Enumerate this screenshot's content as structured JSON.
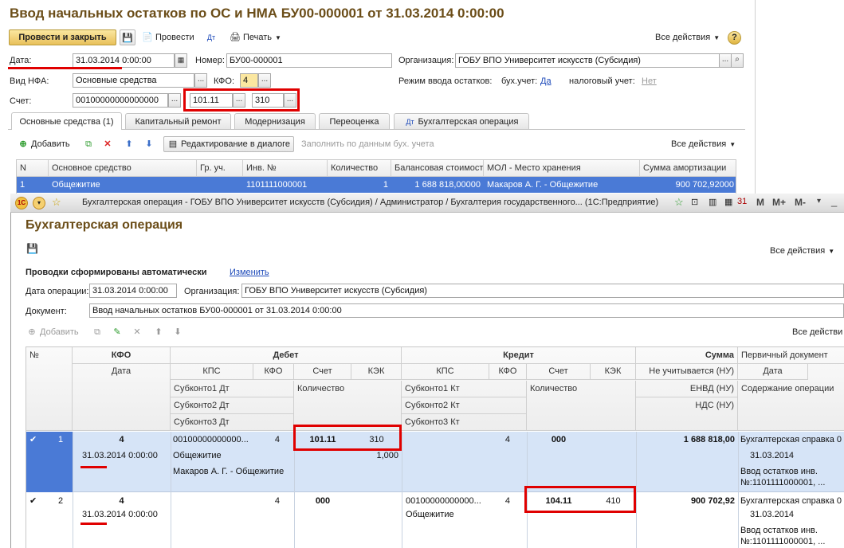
{
  "back": {
    "title": "Ввод начальных остатков по ОС и НМА БУ00-000001 от 31.03.2014 0:00:00",
    "toolbar": {
      "post_close": "Провести и закрыть",
      "post": "Провести",
      "print": "Печать",
      "all_actions": "Все действия",
      "help": "?"
    },
    "fields": {
      "date_label": "Дата:",
      "date_value": "31.03.2014  0:00:00",
      "number_label": "Номер:",
      "number_value": "БУ00-000001",
      "org_label": "Организация:",
      "org_value": "ГОБУ ВПО Университет искусств (Субсидия)",
      "nfa_label": "Вид НФА:",
      "nfa_value": "Основные средства",
      "kfo_label": "КФО:",
      "kfo_value": "4",
      "mode_label": "Режим ввода остатков:",
      "bu_label": "бух.учет:",
      "bu_value": "Да",
      "nu_label": "налоговый учет:",
      "nu_value": "Нет",
      "account_label": "Счет:",
      "account_value": "00100000000000000",
      "account_code": "101.11",
      "kek_value": "310"
    },
    "tabs": [
      "Основные средства (1)",
      "Капитальный ремонт",
      "Модернизация",
      "Переоценка",
      "Бухгалтерская операция"
    ],
    "subtoolbar": {
      "add": "Добавить",
      "edit_dialog": "Редактирование в диалоге",
      "fill": "Заполнить по данным бух. учета",
      "all_actions": "Все действия"
    },
    "grid": {
      "headers": [
        "N",
        "Основное средство",
        "Гр. уч.",
        "Инв. №",
        "Количество",
        "Балансовая стоимость",
        "МОЛ - Место хранения",
        "Сумма амортизации"
      ],
      "row": [
        "1",
        "Общежитие",
        "",
        "1101111000001",
        "1",
        "1 688 818,00000",
        "Макаров А. Г. - Общежитие",
        "900 702,92000"
      ]
    }
  },
  "front": {
    "window_title": "Бухгалтерская операция - ГОБУ ВПО Университет искусств (Субсидия) / Администратор / Бухгалтерия государственного... (1С:Предприятие)",
    "title": "Бухгалтерская операция",
    "all_actions": "Все действия",
    "auto_label": "Проводки сформированы автоматически",
    "change_link": "Изменить",
    "op_date_label": "Дата операции:",
    "op_date_value": "31.03.2014  0:00:00",
    "org_label": "Организация:",
    "org_value": "ГОБУ ВПО Университет искусств (Субсидия)",
    "doc_label": "Документ:",
    "doc_value": "Ввод начальных остатков БУ00-000001 от 31.03.2014 0:00:00",
    "add": "Добавить",
    "all_actions2": "Все действи",
    "grid": {
      "h_num": "№",
      "h_kfo": "КФО",
      "h_date": "Дата",
      "h_debet": "Дебет",
      "h_credit": "Кредит",
      "h_sum": "Сумма",
      "h_primary": "Первичный документ",
      "h_kps": "КПС",
      "h_kfo2": "КФО",
      "h_schet": "Счет",
      "h_kek": "КЭК",
      "h_sub1dt": "Субконто1 Дт",
      "h_sub2dt": "Субконто2 Дт",
      "h_sub3dt": "Субконто3 Дт",
      "h_sub1kt": "Субконто1 Кт",
      "h_sub2kt": "Субконто2 Кт",
      "h_sub3kt": "Субконто3 Кт",
      "h_qty": "Количество",
      "h_qty2": "Количество",
      "h_nu": "Не учитывается (НУ)",
      "h_envd": "ЕНВД (НУ)",
      "h_nds": "НДС (НУ)",
      "h_pdate": "Дата",
      "h_content": "Содержание операции",
      "rows": [
        {
          "num": "1",
          "kfo": "4",
          "date": "31.03.2014 0:00:00",
          "kps_dt": "00100000000000...",
          "kfo_dt": "4",
          "acc_dt": "101.11",
          "kek_dt": "310",
          "sub1_dt": "Общежитие",
          "sub2_dt": "Макаров А. Г. - Общежитие",
          "qty_dt": "1,000",
          "kps_kt": "",
          "kfo_kt": "4",
          "acc_kt": "000",
          "kek_kt": "",
          "sub1_kt": "",
          "sum": "1 688 818,00",
          "pdoc": "Бухгалтерская справка 0",
          "pdate": "31.03.2014",
          "pcontent1": "Ввод остатков инв.",
          "pcontent2": "№:1101111000001, ..."
        },
        {
          "num": "2",
          "kfo": "4",
          "date": "31.03.2014 0:00:00",
          "kps_dt": "",
          "kfo_dt": "4",
          "acc_dt": "000",
          "kek_dt": "",
          "sub1_dt": "",
          "sub2_dt": "",
          "qty_dt": "",
          "kps_kt": "00100000000000...",
          "kfo_kt": "4",
          "acc_kt": "104.11",
          "kek_kt": "410",
          "sub1_kt": "Общежитие",
          "sum": "900 702,92",
          "pdoc": "Бухгалтерская справка 0",
          "pdate": "31.03.2014",
          "pcontent1": "Ввод остатков инв.",
          "pcontent2": "№:1101111000001, ..."
        }
      ]
    }
  },
  "colors": {
    "title": "#6b4d18",
    "accent_red": "#e00000",
    "selected_row": "#4a7ad6",
    "row_bg": "#d6e4f7",
    "link": "#1c49b9"
  }
}
